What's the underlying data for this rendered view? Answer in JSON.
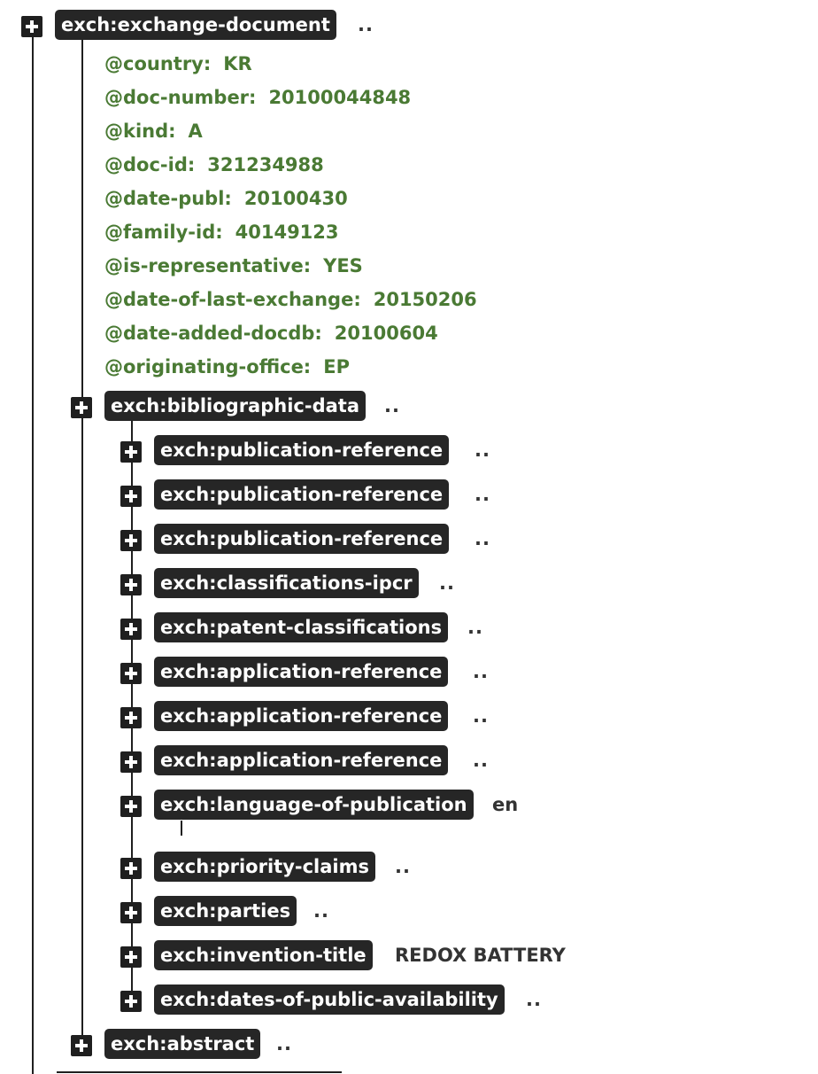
{
  "root": {
    "tag": "exch:exchange-document",
    "ellipsis": "..",
    "attributes": [
      {
        "name": "@country:",
        "value": "KR"
      },
      {
        "name": "@doc-number:",
        "value": "20100044848"
      },
      {
        "name": "@kind:",
        "value": "A"
      },
      {
        "name": "@doc-id:",
        "value": "321234988"
      },
      {
        "name": "@date-publ:",
        "value": "20100430"
      },
      {
        "name": "@family-id:",
        "value": "40149123"
      },
      {
        "name": "@is-representative:",
        "value": "YES"
      },
      {
        "name": "@date-of-last-exchange:",
        "value": "20150206"
      },
      {
        "name": "@date-added-docdb:",
        "value": "20100604"
      },
      {
        "name": "@originating-office:",
        "value": "EP"
      }
    ]
  },
  "bibliographic": {
    "tag": "exch:bibliographic-data",
    "ellipsis": "..",
    "children": [
      {
        "tag": "exch:publication-reference",
        "text": ".."
      },
      {
        "tag": "exch:publication-reference",
        "text": ".."
      },
      {
        "tag": "exch:publication-reference",
        "text": ".."
      },
      {
        "tag": "exch:classifications-ipcr",
        "text": ".."
      },
      {
        "tag": "exch:patent-classifications",
        "text": ".."
      },
      {
        "tag": "exch:application-reference",
        "text": ".."
      },
      {
        "tag": "exch:application-reference",
        "text": ".."
      },
      {
        "tag": "exch:application-reference",
        "text": ".."
      },
      {
        "tag": "exch:language-of-publication",
        "text": "en"
      },
      {
        "tag": "exch:priority-claims",
        "text": ".."
      },
      {
        "tag": "exch:parties",
        "text": ".."
      },
      {
        "tag": "exch:invention-title",
        "text": "REDOX BATTERY"
      },
      {
        "tag": "exch:dates-of-public-availability",
        "text": ".."
      }
    ]
  },
  "abstract": {
    "tag": "exch:abstract",
    "ellipsis": ".."
  }
}
